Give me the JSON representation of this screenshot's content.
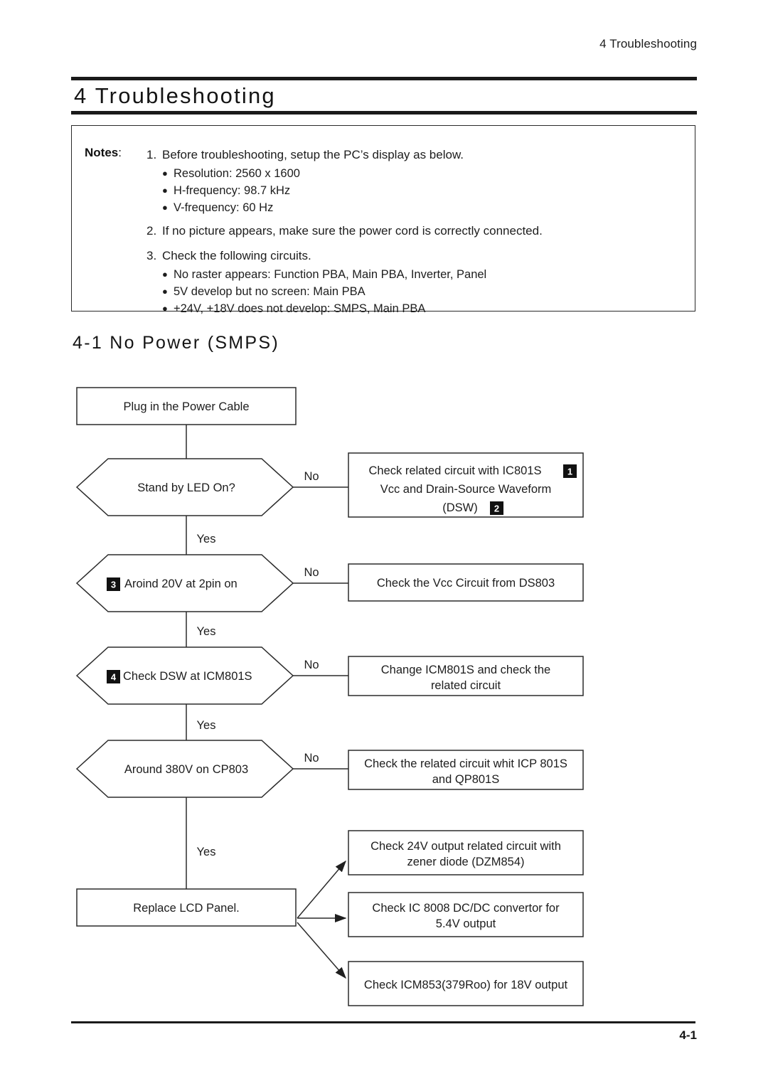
{
  "header": {
    "running_title": "4 Troubleshooting"
  },
  "title": {
    "chapter": "4 Troubleshooting"
  },
  "notes": {
    "label": "Notes",
    "colon": ":",
    "items": [
      {
        "num": "1.",
        "text": "Before troubleshooting, setup the PC’s display as below."
      },
      {
        "num": "2.",
        "text": "If no picture appears, make sure the power cord is correctly connected."
      },
      {
        "num": "3.",
        "text": "Check the following circuits."
      }
    ],
    "sub_items_1": [
      "Resolution: 2560 x 1600",
      "H-frequency: 98.7 kHz",
      "V-frequency: 60 Hz"
    ],
    "sub_items_3": [
      "No raster appears: Function PBA,  Main PBA, Inverter, Panel",
      "5V develop but no screen: Main PBA",
      "+24V, +18V does not develop: SMPS, Main PBA"
    ]
  },
  "section": {
    "heading": "4-1 No Power (SMPS)"
  },
  "flowchart": {
    "nodes": {
      "start": "Plug in the Power Cable",
      "decision1": "Stand by LED On?",
      "decision1_badge": "",
      "result1_line1": "Check related circuit with IC801S",
      "result1_badge1": "1",
      "result1_line2": "Vcc and Drain-Source Waveform",
      "result1_line3": "(DSW)",
      "result1_badge2": "2",
      "decision2": "Aroind 20V at 2pin on",
      "decision2_badge": "3",
      "result2": "Check the Vcc Circuit from DS803",
      "decision3": "Check DSW at ICM801S",
      "decision3_badge": "4",
      "result3_line1": "Change ICM801S and check the",
      "result3_line2": "related circuit",
      "decision4": "Around 380V on CP803",
      "result4_line1": "Check the related circuit whit ICP 801S",
      "result4_line2": "and QP801S",
      "end": "Replace LCD Panel.",
      "final1_line1": "Check 24V output related circuit with",
      "final1_line2": "zener diode (DZM854)",
      "final2_line1": "Check IC 8008 DC/DC convertor for",
      "final2_line2": "5.4V output",
      "final3": "Check ICM853(379Roo) for 18V output"
    },
    "edges": {
      "no_1": "No",
      "yes_1": "Yes",
      "no_2": "No",
      "yes_2": "Yes",
      "no_3": "No",
      "yes_3": "Yes",
      "no_4": "No",
      "yes_4": "Yes"
    }
  },
  "footer": {
    "page_number": "4-1"
  },
  "colors": {
    "ink": "#1a1a1a",
    "rule": "#1a1a1a",
    "shape_stroke": "#2b2b2b",
    "badge_bg": "#111111"
  }
}
